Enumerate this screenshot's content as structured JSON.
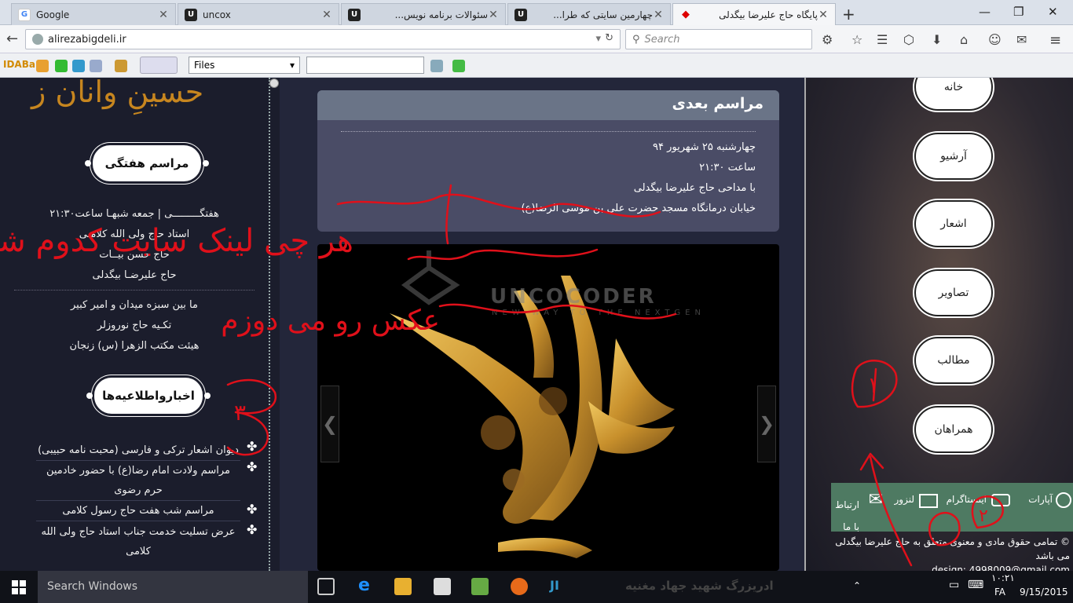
{
  "browser": {
    "tabs": [
      {
        "title": "Google",
        "active": false
      },
      {
        "title": "uncox",
        "active": false
      },
      {
        "title": "سئوالات برنامه نویس...",
        "active": false
      },
      {
        "title": "چهارمین سایتی که طرا...",
        "active": false
      },
      {
        "title": "پایگاه حاج علیرضا بیگدلی",
        "active": true
      }
    ],
    "url": "alirezabigdeli.ir",
    "search_placeholder": "Search"
  },
  "toolbar": {
    "logo_main": "IDABar",
    "files_label": "Files"
  },
  "left": {
    "logo_text": "حسینِ وانان ز",
    "weekly_title": "مراسم هفتگی",
    "weekly_lines": [
      "هفتگـــــــــی | جمعه شبهـا ساعت۲۱:۳۰",
      "استاد حاج ولی الله کلامـی",
      "حاج حسن بیــات",
      "حاج علیرضـا بیگدلی"
    ],
    "venue_lines": [
      "ما بین سبزه میدان و امیر کبیر",
      "تکـیه حاج نوروزلر",
      "هیئت مکتب الزهرا (س) زنجان"
    ],
    "news_title": "اخبارواطلاعیه‌ها",
    "news_items": [
      "دیوان اشعار ترکی و فارسی (محبت نامه حبیبی)",
      "مراسم ولادت امام رضا(ع) با حضور خادمین حرم رضوی",
      "مراسم شب هفت حاج رسول کلامی",
      "عرض تسلیت خدمت جناب استاد حاج ولی الله کلامی"
    ]
  },
  "center": {
    "event_title": "مراسم بعدی",
    "event_lines": [
      "چهارشنبه  ۲۵ شهریور ۹۴",
      "ساعت ۲۱:۳۰",
      "با مداحی حاج علیرضا بیگدلی",
      "خیابان درمانگاه مسجد حضرت علی بن موسی الرضا(ع)"
    ],
    "watermark": "UNCOCODER",
    "watermark_sub": "NEW WAY TO THE NEXTGEN"
  },
  "right": {
    "menu": [
      "خانه",
      "آرشیو",
      "اشعار",
      "تصاویر",
      "مطالب",
      "همراهان"
    ],
    "social": [
      "آپارات",
      "اینستاگرام",
      "لنزور",
      "ارتباط با ما"
    ],
    "copyright": "© تمامی حقوق مادی و معنوی متعلق به حاج علیرضا بیگدلی می باشد",
    "design": "design: 4998009@gmail.com"
  },
  "taskbar": {
    "search_placeholder": "Search Windows",
    "time": "۱۰:۲۱",
    "lang": "FA",
    "date": "9/15/2015",
    "ticker": "ادریزرگ شهید جهاد مغنیه"
  },
  "annotations": {
    "scribble_line1": "هر چی لینک سایت کدوم شد",
    "scribble_line2": "عکس رو می دوزم",
    "num1": "۱",
    "num2": "۲",
    "num3": "۳"
  },
  "colors": {
    "accent_gold": "#c7861f",
    "ink_red": "#e0101a",
    "social_green": "#4e7a62"
  }
}
